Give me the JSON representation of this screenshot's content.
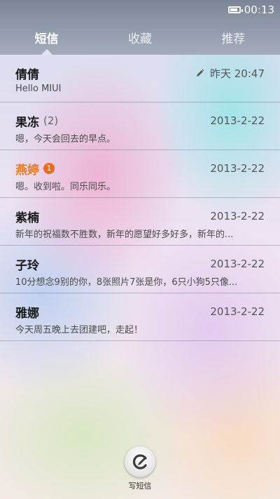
{
  "status_bar": {
    "time": "00:13",
    "battery_level": 0.85,
    "battery_icon": "battery-icon"
  },
  "tabs": [
    {
      "label": "短信",
      "active": true
    },
    {
      "label": "收藏",
      "active": false
    },
    {
      "label": "推荐",
      "active": false
    }
  ],
  "messages": [
    {
      "name": "倩倩",
      "count": "",
      "unread_badge": "",
      "time": "昨天 20:47",
      "draft": true,
      "preview": "Hello MIUI"
    },
    {
      "name": "果冻",
      "count": "(2)",
      "unread_badge": "",
      "time": "2013-2-22",
      "draft": false,
      "preview": "嗯，今天会回去的早点。"
    },
    {
      "name": "燕婷",
      "count": "",
      "unread_badge": "1",
      "time": "2013-2-22",
      "draft": false,
      "preview": "嗯。收到啦。同乐同乐。"
    },
    {
      "name": "紫楠",
      "count": "",
      "unread_badge": "",
      "time": "2013-2-22",
      "draft": false,
      "preview": "新年的祝福数不胜数，新年的愿望好多好多，新年的..."
    },
    {
      "name": "子玲",
      "count": "",
      "unread_badge": "",
      "time": "2013-2-22",
      "draft": false,
      "preview": "10分想念9别的你，8张照片7张是你，6只小狗5只像..."
    },
    {
      "name": "雅娜",
      "count": "",
      "unread_badge": "",
      "time": "2013-2-22",
      "draft": false,
      "preview": "今天周五晚上去团建吧，走起！"
    }
  ],
  "compose": {
    "label": "写短信",
    "icon": "compose-icon"
  },
  "colors": {
    "unread_name": "#ef7a20",
    "badge": "#f26a1b"
  }
}
